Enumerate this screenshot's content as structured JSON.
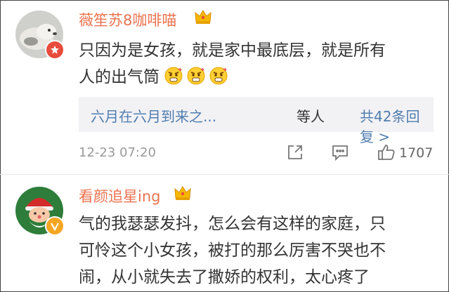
{
  "comments": [
    {
      "username": "薇笙苏8咖啡喵",
      "lines": [
        "只因为是女孩，就是家中最底层，就是所有",
        "人的出气筒"
      ],
      "emoji_count": 3,
      "emoji_icon": "angry-face-emoji",
      "replies": {
        "first_replier": "六月在六月到来之...",
        "middle": "等人",
        "count_link": "共42条回复 >"
      },
      "timestamp": "12-23 07:20",
      "likes": "1707"
    },
    {
      "username": "看颜追星ing",
      "lines": [
        "气的我瑟瑟发抖，怎么会有这样的家庭，只",
        "可怜这个小女孩，被打的那么厉害不哭也不",
        "闹，从小就失去了撒娇的权利，太心疼了"
      ]
    }
  ],
  "icons": {
    "crown": "crown-icon",
    "share": "share-icon",
    "comment": "comment-icon",
    "like": "thumbs-up-icon"
  },
  "colors": {
    "username": "#eb7350",
    "link": "#507daf",
    "reply_bg": "#f2f2f5",
    "meta": "#999999",
    "text": "#333333"
  }
}
